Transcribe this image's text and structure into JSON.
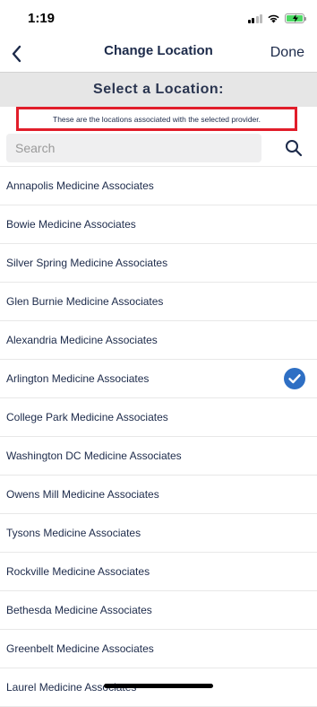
{
  "status_bar": {
    "time": "1:19"
  },
  "nav": {
    "title": "Change Location",
    "done_label": "Done"
  },
  "header": {
    "title": "Select a Location:"
  },
  "notice": {
    "text": "These are the locations associated with the selected provider."
  },
  "search": {
    "placeholder": "Search",
    "value": ""
  },
  "colors": {
    "accent": "#2e6fc4",
    "text": "#1c2a4a",
    "notice_border": "#e11d2a",
    "header_bg": "#e6e6e6"
  },
  "locations": [
    {
      "label": "Annapolis Medicine Associates",
      "selected": false
    },
    {
      "label": "Bowie Medicine Associates",
      "selected": false
    },
    {
      "label": "Silver Spring Medicine Associates",
      "selected": false
    },
    {
      "label": "Glen Burnie Medicine Associates",
      "selected": false
    },
    {
      "label": "Alexandria Medicine Associates",
      "selected": false
    },
    {
      "label": "Arlington Medicine Associates",
      "selected": true
    },
    {
      "label": "College Park Medicine Associates",
      "selected": false
    },
    {
      "label": "Washington DC Medicine Associates",
      "selected": false
    },
    {
      "label": "Owens Mill Medicine Associates",
      "selected": false
    },
    {
      "label": "Tysons Medicine Associates",
      "selected": false
    },
    {
      "label": "Rockville Medicine Associates",
      "selected": false
    },
    {
      "label": "Bethesda Medicine Associates",
      "selected": false
    },
    {
      "label": "Greenbelt Medicine Associates",
      "selected": false
    },
    {
      "label": "Laurel Medicine Associates",
      "selected": false
    }
  ]
}
